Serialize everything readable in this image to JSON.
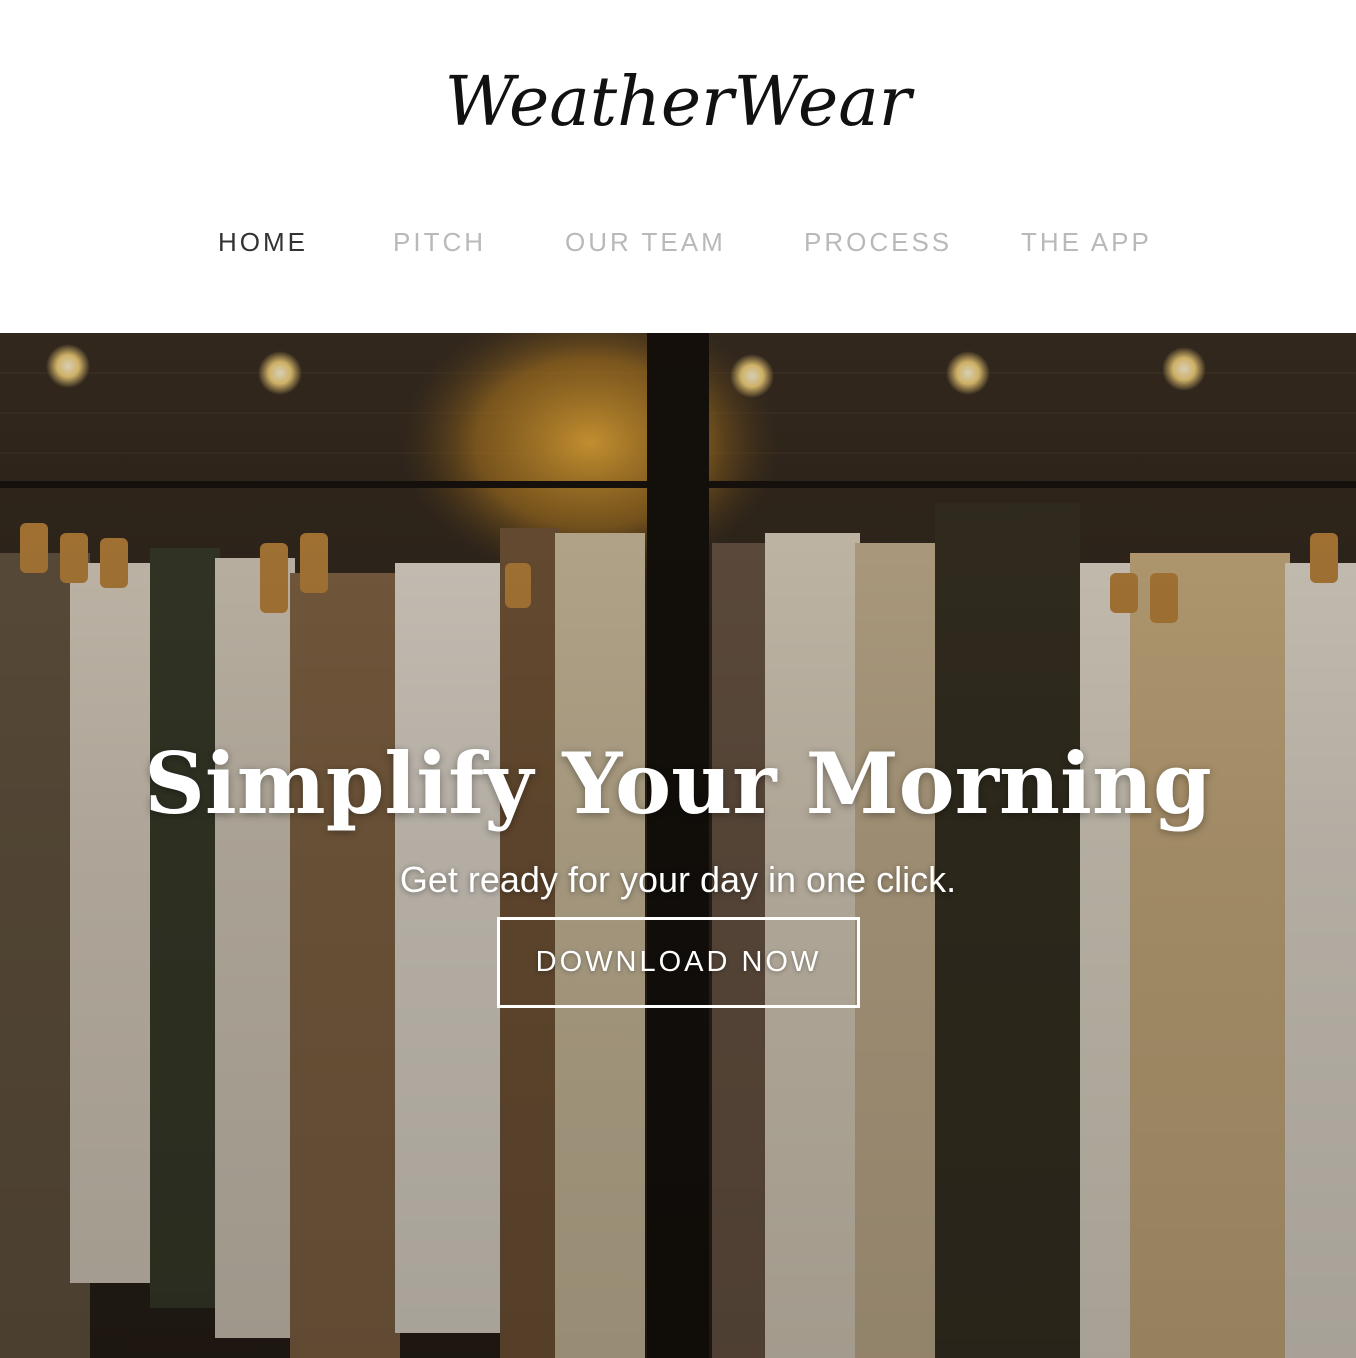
{
  "brand": {
    "logo_text": "WeatherWear"
  },
  "nav": {
    "items": [
      {
        "label": "HOME",
        "active": true
      },
      {
        "label": "PITCH",
        "active": false
      },
      {
        "label": "OUR TEAM",
        "active": false
      },
      {
        "label": "PROCESS",
        "active": false
      },
      {
        "label": "THE APP",
        "active": false
      }
    ]
  },
  "hero": {
    "title": "Simplify Your Morning",
    "subtitle": "Get ready for your day in one click.",
    "cta_label": "DOWNLOAD NOW",
    "background_image": "clothing-rack-photo"
  },
  "colors": {
    "nav_active": "#333333",
    "nav_inactive": "#b9b9b9",
    "hero_text": "#ffffff"
  }
}
